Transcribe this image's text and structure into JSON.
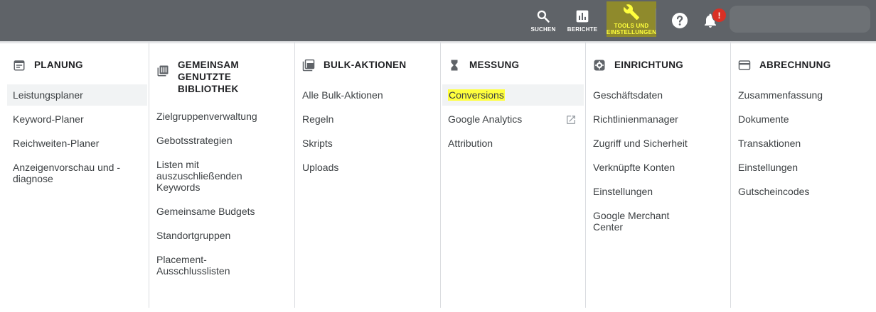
{
  "topbar": {
    "search_label": "SUCHEN",
    "reports_label": "BERICHTE",
    "tools_label_line1": "TOOLS UND",
    "tools_label_line2": "EINSTELLUNGEN",
    "notification_badge": "!",
    "highlight_color": "#ffff3d"
  },
  "columns": [
    {
      "title": "PLANUNG",
      "icon": "calendar-icon",
      "items": [
        "Leistungsplaner",
        "Keyword-Planer",
        "Reichweiten-Planer",
        "Anzeigenvorschau und -diagnose"
      ]
    },
    {
      "title_lines": [
        "GEMEINSAM",
        "GENUTZTE",
        "BIBLIOTHEK"
      ],
      "icon": "library-icon",
      "items": [
        "Zielgruppenverwaltung",
        "Gebotsstrategien",
        "Listen mit auszuschließenden Keywords",
        "Gemeinsame Budgets",
        "Standortgruppen",
        "Placement-Ausschlusslisten"
      ]
    },
    {
      "title": "BULK-AKTIONEN",
      "icon": "copy-stack-icon",
      "items": [
        "Alle Bulk-Aktionen",
        "Regeln",
        "Skripts",
        "Uploads"
      ]
    },
    {
      "title": "MESSUNG",
      "icon": "hourglass-icon",
      "items": [
        "Conversions",
        "Google Analytics",
        "Attribution"
      ]
    },
    {
      "title": "EINRICHTUNG",
      "icon": "gear-box-icon",
      "items": [
        "Geschäftsdaten",
        "Richtlinienmanager",
        "Zugriff und Sicherheit",
        "Verknüpfte Konten",
        "Einstellungen",
        "Google Merchant Center"
      ]
    },
    {
      "title": "ABRECHNUNG",
      "icon": "credit-card-icon",
      "items": [
        "Zusammenfassung",
        "Dokumente",
        "Transaktionen",
        "Einstellungen",
        "Gutscheincodes"
      ]
    }
  ]
}
